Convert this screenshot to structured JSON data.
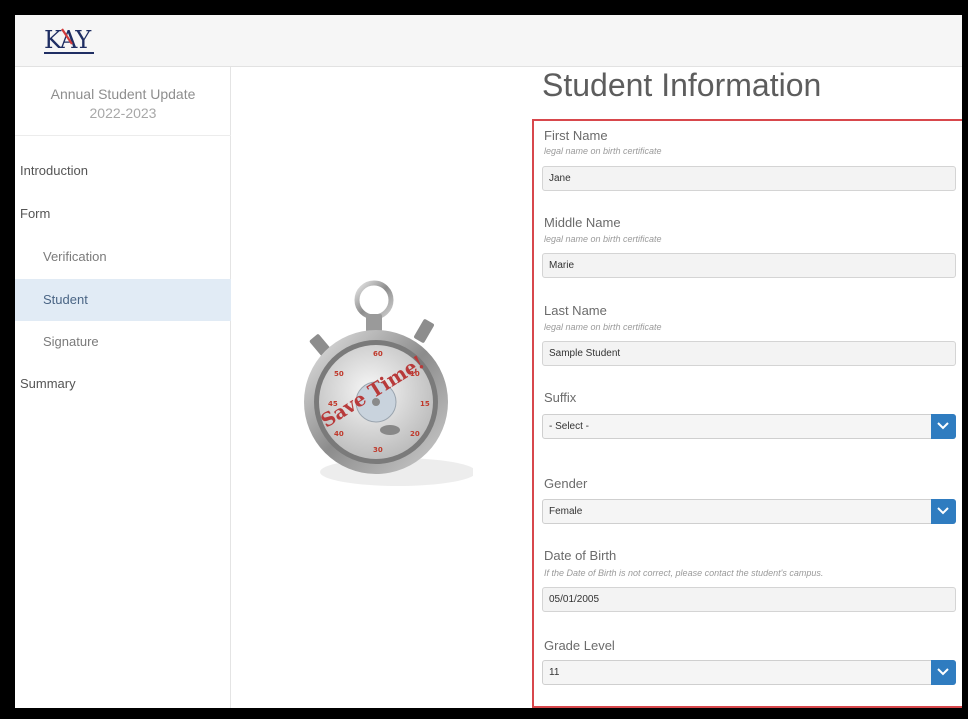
{
  "header": {
    "logo_text": "KAY"
  },
  "sidebar": {
    "title": "Annual Student Update",
    "year": "2022-2023",
    "items": [
      {
        "label": "Introduction",
        "type": "section"
      },
      {
        "label": "Form",
        "type": "section"
      },
      {
        "label": "Verification",
        "type": "sub"
      },
      {
        "label": "Student",
        "type": "sub",
        "active": true
      },
      {
        "label": "Signature",
        "type": "sub"
      },
      {
        "label": "Summary",
        "type": "section"
      }
    ]
  },
  "illustration": {
    "text": "Save Time!"
  },
  "main": {
    "title": "Student Information",
    "fields": {
      "first_name": {
        "label": "First Name",
        "hint": "legal name on birth certificate",
        "value": "Jane"
      },
      "middle_name": {
        "label": "Middle Name",
        "hint": "legal name on birth certificate",
        "value": "Marie"
      },
      "last_name": {
        "label": "Last Name",
        "hint": "legal name on birth certificate",
        "value": "Sample Student"
      },
      "suffix": {
        "label": "Suffix",
        "value": "- Select -"
      },
      "gender": {
        "label": "Gender",
        "value": "Female"
      },
      "dob": {
        "label": "Date of Birth",
        "hint": "If the Date of Birth is not correct, please contact the student's campus.",
        "value": "05/01/2005"
      },
      "grade": {
        "label": "Grade Level",
        "value": "11"
      }
    }
  },
  "colors": {
    "accent": "#2f7cc0",
    "highlight_border": "#d8474c",
    "active_nav": "#e1ebf5"
  }
}
